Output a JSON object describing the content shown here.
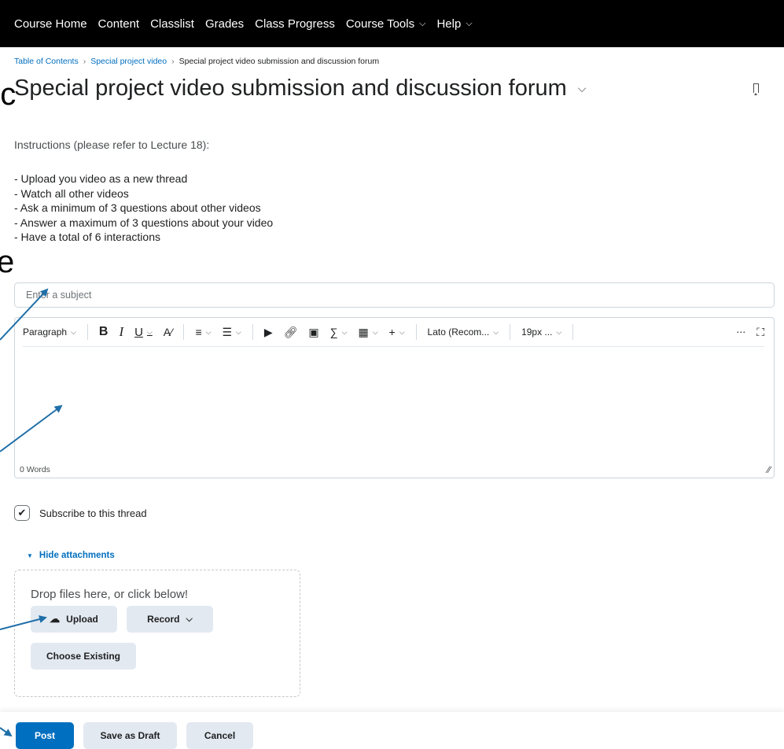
{
  "nav": {
    "items": [
      {
        "label": "Course Home"
      },
      {
        "label": "Content"
      },
      {
        "label": "Classlist"
      },
      {
        "label": "Grades"
      },
      {
        "label": "Class Progress"
      },
      {
        "label": "Course Tools",
        "has_dropdown": true
      },
      {
        "label": "Help",
        "has_dropdown": true
      }
    ]
  },
  "breadcrumb": {
    "items": [
      "Table of Contents",
      "Special project video",
      "Special project video submission and discussion forum"
    ]
  },
  "page": {
    "title": "Special project video submission and discussion forum",
    "instructions": "Instructions (please refer to Lecture 18):",
    "list": [
      "- Upload you video as a new thread",
      "- Watch all other videos",
      "- Ask a minimum of 3 questions about other videos",
      "- Answer a maximum of 3 questions about your video",
      "- Have a total of 6 interactions"
    ]
  },
  "form": {
    "subject_placeholder": "Enter a subject",
    "toolbar": {
      "paragraph": "Paragraph",
      "bold": "B",
      "italic": "I",
      "underline": "U",
      "font": "Lato (Recom...",
      "size": "19px ...",
      "more": "⋯"
    },
    "word_count": "0 Words",
    "subscribe_label": "Subscribe to this thread",
    "subscribe_checked": true,
    "hide_attachments": "Hide attachments",
    "drop_text": "Drop files here, or click below!",
    "upload": "Upload",
    "record": "Record",
    "choose_existing": "Choose Existing",
    "post": "Post",
    "save_draft": "Save as Draft",
    "cancel": "Cancel"
  },
  "colors": {
    "accent": "#006fbf",
    "nav_bg": "#000000",
    "arrow": "#1f6fa8"
  },
  "overlay": {
    "partial_text_top": "nc",
    "partial_text_mid": "e"
  }
}
